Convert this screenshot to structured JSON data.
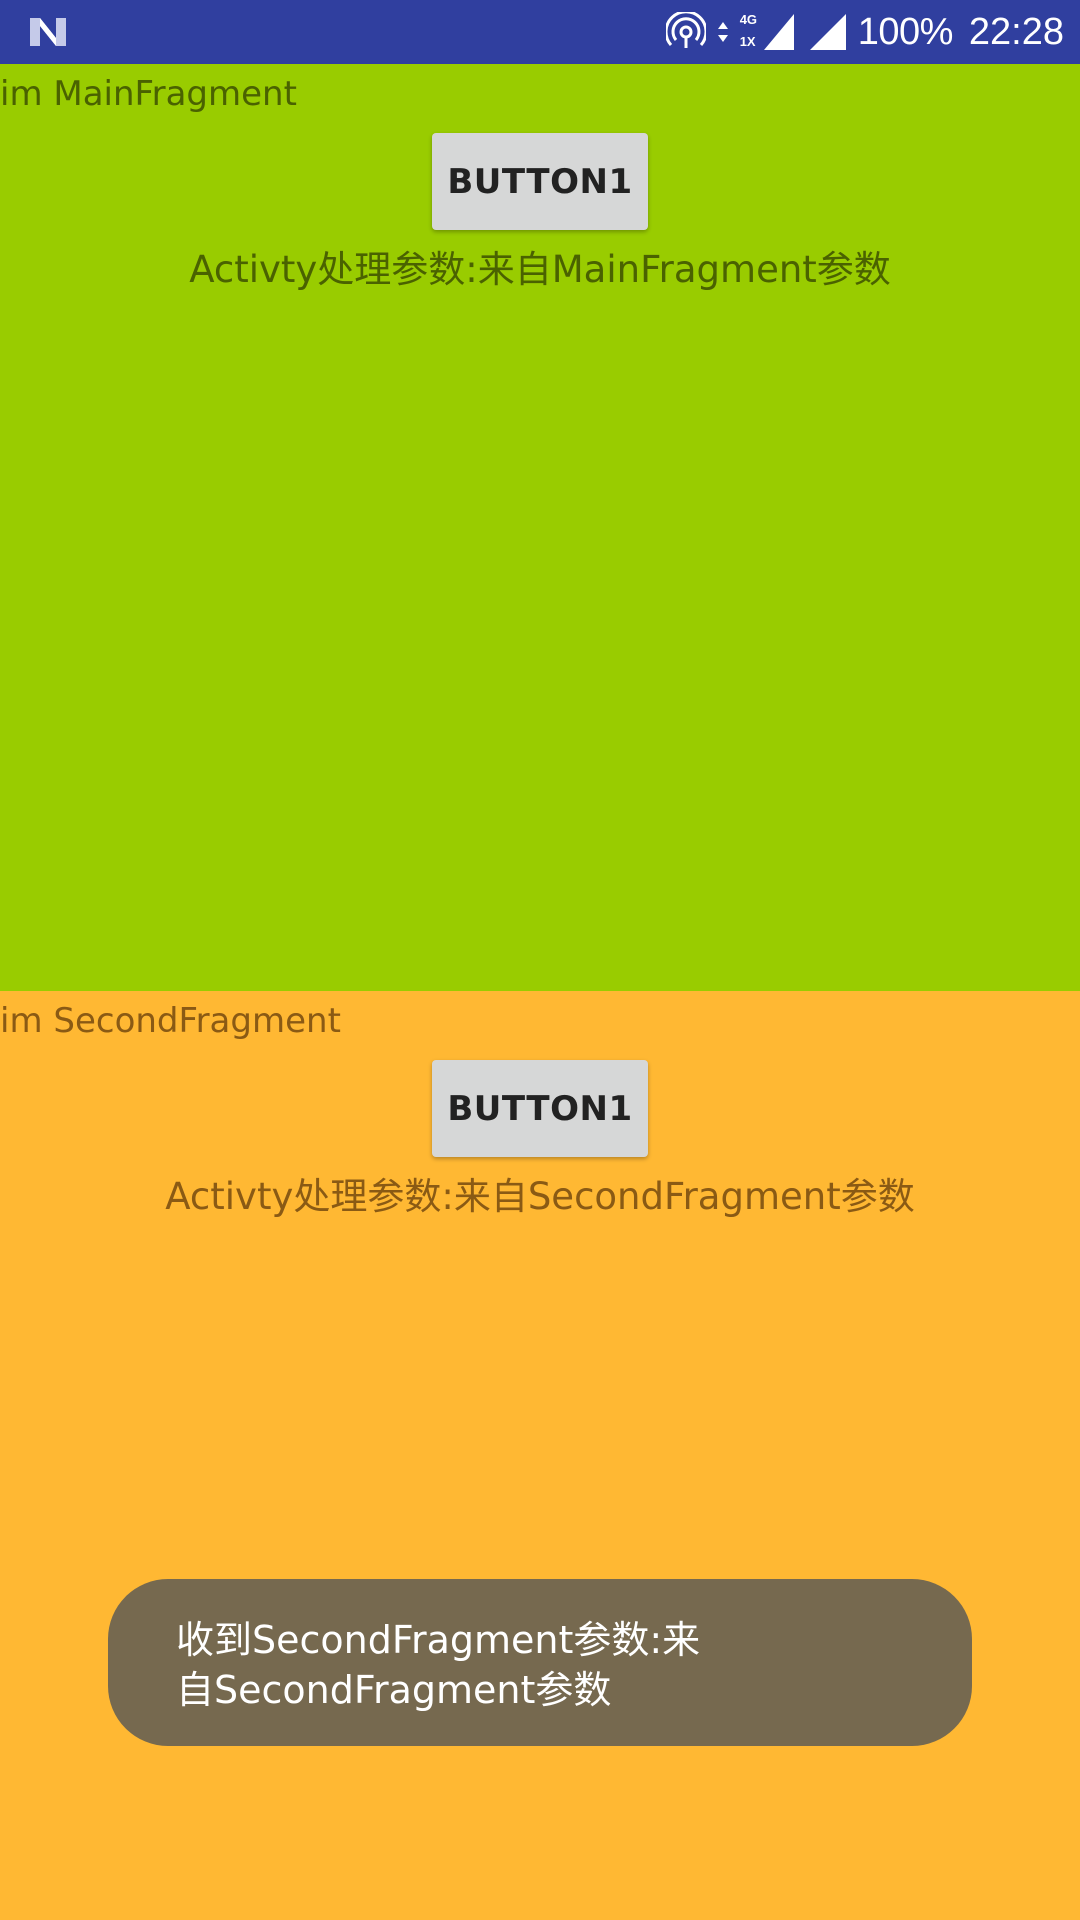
{
  "status_bar": {
    "battery": "100%",
    "time": "22:28",
    "network_label": "4G",
    "network_sub_label": "1X",
    "icons": [
      "n-logo-icon",
      "hotspot-icon",
      "data-activity-icon",
      "signal-icon",
      "signal-full-icon"
    ]
  },
  "main_fragment": {
    "title": "im MainFragment",
    "button_label": "BUTTON1",
    "result_text": "Activty处理参数:来自MainFragment参数",
    "background_color": "#99cc00"
  },
  "second_fragment": {
    "title": "im SecondFragment",
    "button_label": "BUTTON1",
    "result_text": "Activty处理参数:来自SecondFragment参数",
    "background_color": "#ffb833"
  },
  "toast": {
    "message": "收到SecondFragment参数:来自SecondFragment参数"
  },
  "colors": {
    "status_bar": "#303f9f",
    "button": "#d6d7d7",
    "toast": "#76694f"
  }
}
